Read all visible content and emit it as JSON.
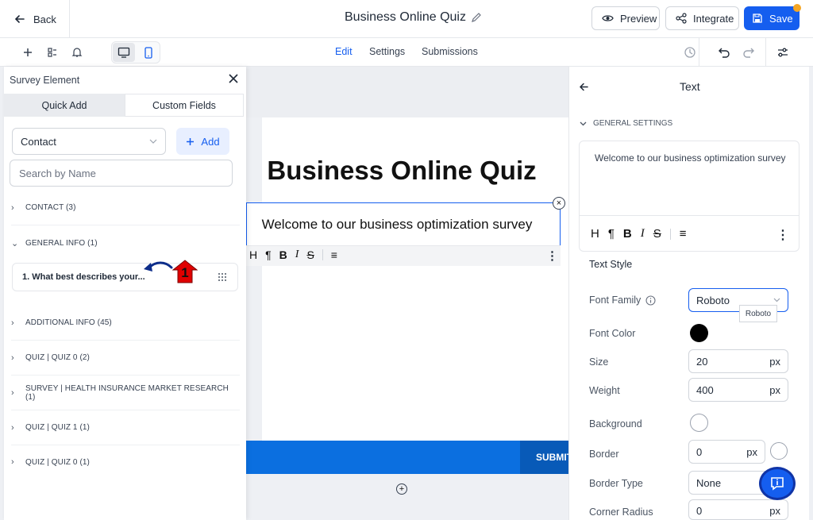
{
  "header": {
    "back_label": "Back",
    "title": "Business Online Quiz",
    "preview_label": "Preview",
    "integrate_label": "Integrate",
    "save_label": "Save"
  },
  "tabs": [
    {
      "label": "Edit"
    },
    {
      "label": "Settings"
    },
    {
      "label": "Submissions"
    }
  ],
  "left_panel": {
    "title": "Survey Element",
    "tabs": [
      {
        "label": "Quick Add"
      },
      {
        "label": "Custom Fields"
      }
    ],
    "select_value": "Contact",
    "add_label": "Add",
    "search_placeholder": "Search by Name",
    "categories": [
      {
        "label": "CONTACT (3)"
      },
      {
        "label": "GENERAL INFO (1)"
      },
      {
        "label": "ADDITIONAL INFO (45)"
      },
      {
        "label": "QUIZ | QUIZ 0 (2)"
      },
      {
        "label": "SURVEY | HEALTH INSURANCE MARKET RESEARCH (1)"
      },
      {
        "label": "QUIZ | QUIZ 1 (1)"
      },
      {
        "label": "QUIZ | QUIZ 0 (1)"
      }
    ],
    "field_item": "1. What best describes your...",
    "annotation_number": "1"
  },
  "canvas": {
    "heading": "Business Online Quiz",
    "text_block": "Welcome to our business optimization survey",
    "submit_label": "SUBMIT"
  },
  "right_panel": {
    "title": "Text",
    "section": "GENERAL SETTINGS",
    "editor_text": "Welcome to our business optimization survey",
    "text_style_label": "Text Style",
    "font_family_label": "Font Family",
    "font_family_value": "Roboto",
    "font_tooltip": "Roboto",
    "font_color_label": "Font Color",
    "font_color": "#000000",
    "size_label": "Size",
    "size_value": "20",
    "weight_label": "Weight",
    "weight_value": "400",
    "background_label": "Background",
    "border_label": "Border",
    "border_value": "0",
    "border_type_label": "Border Type",
    "border_type_value": "None",
    "corner_radius_label": "Corner Radius",
    "corner_radius_value": "0",
    "unit": "px"
  },
  "colors": {
    "accent": "#155eef",
    "submit_bar": "#0b6fe0",
    "annotation_red": "#e00000",
    "annotation_arrow": "#0d2d8a"
  }
}
